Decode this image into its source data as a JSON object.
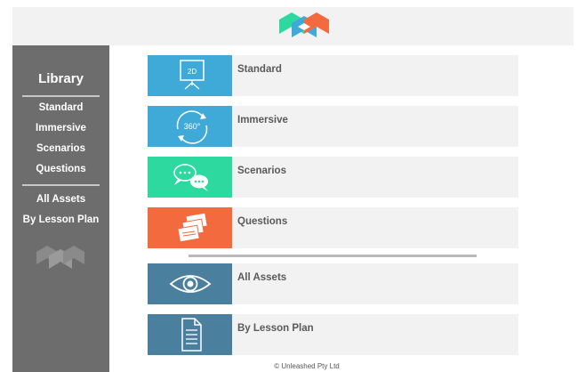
{
  "header": {
    "logo": "unleashed-logo-icon"
  },
  "sidebar": {
    "title": "Library",
    "group1": [
      "Standard",
      "Immersive",
      "Scenarios",
      "Questions"
    ],
    "group2": [
      "All Assets",
      "By Lesson Plan"
    ]
  },
  "cards": [
    {
      "label": "Standard",
      "icon": "2d-screen-icon",
      "icon_text": "2D",
      "color": "#3fa9d8"
    },
    {
      "label": "Immersive",
      "icon": "360-rotate-icon",
      "icon_text": "360°",
      "color": "#3fa9d8"
    },
    {
      "label": "Scenarios",
      "icon": "chat-bubbles-icon",
      "color": "#2ed9a0"
    },
    {
      "label": "Questions",
      "icon": "question-cards-icon",
      "color": "#f26a3d"
    },
    {
      "label": "All Assets",
      "icon": "eye-icon",
      "color": "#4a7f9e"
    },
    {
      "label": "By Lesson Plan",
      "icon": "document-icon",
      "color": "#4a7f9e"
    }
  ],
  "footer": {
    "copyright": "© Unleashed Pty Ltd"
  },
  "colors": {
    "blue": "#3fa9d8",
    "teal": "#2ed9a0",
    "orange": "#f26a3d",
    "slate": "#4a7f9e",
    "sidebar": "#6d6d6d"
  }
}
